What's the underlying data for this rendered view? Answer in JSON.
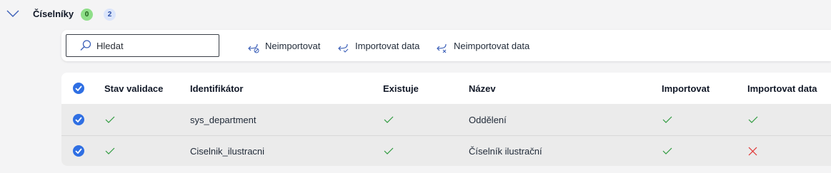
{
  "section": {
    "title": "Číselníky",
    "badge_green": "0",
    "badge_blue": "2"
  },
  "toolbar": {
    "search_placeholder": "Hledat",
    "buttons": [
      {
        "label": "Neimportovat",
        "icon": "skip-import-icon"
      },
      {
        "label": "Importovat data",
        "icon": "import-data-icon"
      },
      {
        "label": "Neimportovat data",
        "icon": "skip-import-data-icon"
      }
    ]
  },
  "table": {
    "columns": [
      "Stav validace",
      "Identifikátor",
      "Existuje",
      "Název",
      "Importovat",
      "Importovat data"
    ],
    "rows": [
      {
        "selected": true,
        "validation": "ok",
        "identifier": "sys_department",
        "exists": "ok",
        "name": "Oddělení",
        "import": "ok",
        "import_data": "ok"
      },
      {
        "selected": true,
        "validation": "ok",
        "identifier": "Ciselnik_ilustracni",
        "exists": "ok",
        "name": "Číselník ilustrační",
        "import": "ok",
        "import_data": "no"
      }
    ]
  },
  "colors": {
    "accent": "#2f6fe3",
    "check_green": "#2e9a3e",
    "cross_red": "#e0312f",
    "badge_green_bg": "#8fdf89",
    "badge_blue_bg": "#dbe5fb"
  }
}
